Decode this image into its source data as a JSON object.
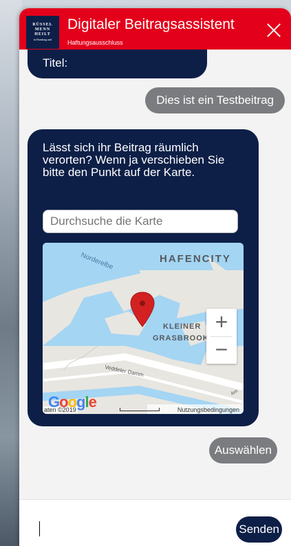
{
  "header": {
    "logo_lines": [
      "RÜSSEL",
      "MENN",
      "HEILT"
    ],
    "logo_small": "in Hamburg und",
    "title": "Digitaler Beitragsassistent",
    "subtitle": "Haftungsausschluss"
  },
  "chat": {
    "prev_bot_text": "Titel:",
    "user_message": "Dies ist ein Testbeitrag",
    "bot_question": "Lässt sich ihr Beitrag räumlich verorten? Wenn ja verschieben Sie bitte den Punkt auf der Karte.",
    "search_placeholder": "Durchsuche die Karte",
    "select_label": "Auswählen"
  },
  "map": {
    "labels": {
      "hafencity": "HAFENCITY",
      "norderelbe": "Norderelbe",
      "kleiner_grasbrook_1": "KLEINER",
      "kleiner_grasbrook_2": "GRASBROOK",
      "veddeler_damm": "Veddeler Damm",
      "am": "Am"
    },
    "google_letters": [
      "G",
      "o",
      "o",
      "g",
      "l",
      "e"
    ],
    "data_text": "aten",
    "data_text_2": "©2019",
    "terms": "Nutzungsbedingungen",
    "zoom_in": "+",
    "zoom_out": "−",
    "colors": {
      "water": "#a4d5f3",
      "land": "#e8e6e1",
      "road": "#ffffff",
      "marker": "#d32121"
    }
  },
  "composer": {
    "send_label": "Senden"
  },
  "colors": {
    "brand_red": "#e3001b",
    "navy": "#0d1f47",
    "gray_bubble": "#7a7c7f"
  }
}
